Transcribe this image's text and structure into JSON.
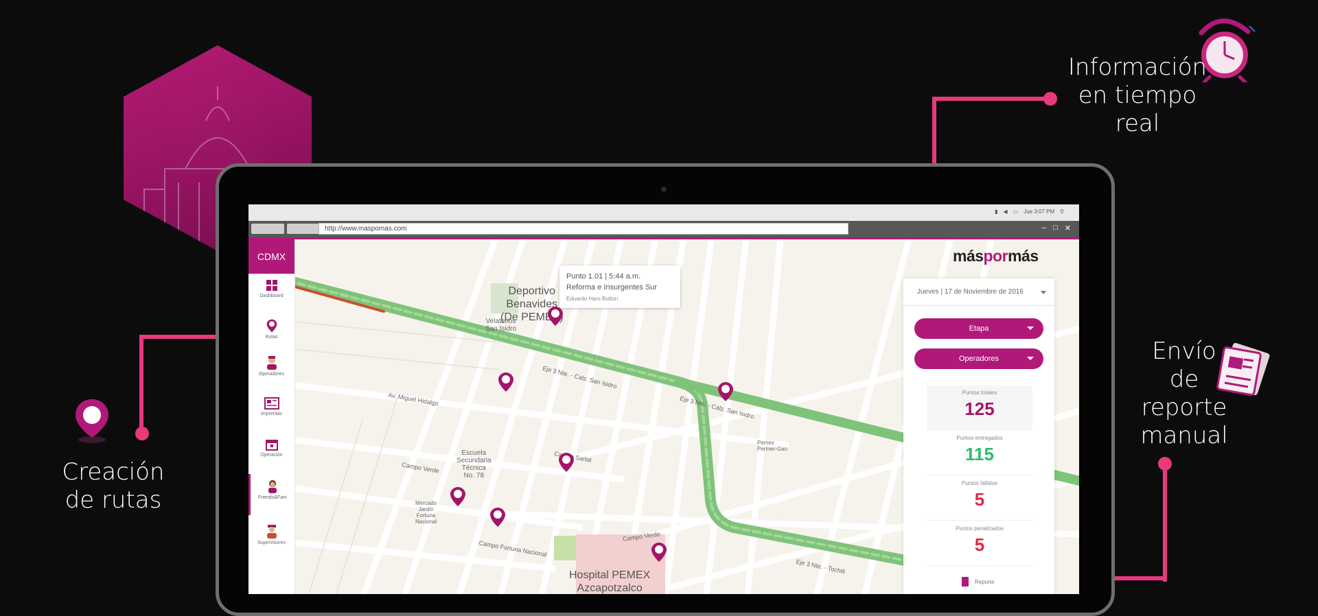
{
  "callouts": {
    "realtime": [
      "Información",
      "en tiempo",
      "real"
    ],
    "routes": [
      "Creación",
      "de rutas"
    ],
    "report": [
      "Envío",
      "de",
      "reporte",
      "manual"
    ]
  },
  "browser": {
    "url": "http://www.maspomas.com",
    "tray_time": "Jue 3:07 PM"
  },
  "app": {
    "city": "CDMX",
    "logo_prefix": "más",
    "logo_mid": "por",
    "logo_suffix": "más",
    "accent": "#b0197a",
    "nav": [
      {
        "label": "Dashboard",
        "icon": "dashboard-icon"
      },
      {
        "label": "Rutas",
        "icon": "map-pin-icon"
      },
      {
        "label": "Operadores",
        "icon": "operator-icon"
      },
      {
        "label": "Imprentas",
        "icon": "newspaper-icon"
      },
      {
        "label": "Operación",
        "icon": "calendar-icon"
      },
      {
        "label": "Friends&Fam",
        "icon": "person-icon"
      },
      {
        "label": "Supervisores",
        "icon": "supervisor-icon"
      }
    ]
  },
  "popup": {
    "line1": "Punto 1.01 | 5:44 a.m.",
    "line2": "Reforma e Insurgentes Sur",
    "line3": "Eduardo Haro Button"
  },
  "map_labels": {
    "deportivo": [
      "Deportivo",
      "Benavides",
      "(De PEMEX)"
    ],
    "hospital": [
      "Hospital PEMEX",
      "Azcapotzalco"
    ],
    "velatorios": [
      "Velatorios",
      "San Isidro"
    ],
    "escuela": [
      "Escuela",
      "Secundaria",
      "Técnica",
      "No. 78"
    ],
    "mercado": [
      "Mercado",
      "Jardín",
      "Fortuna",
      "Nacional"
    ],
    "pemex": [
      "Pemex",
      "Permer-Gan"
    ],
    "eje3": "Eje 3 Nte. - Calz. San Isidro",
    "eje3b": "Eje 3 Nte. - Calz. San Isidro",
    "miguel": "Av. Miguel Hidalgo",
    "campo_verde": "Campo Verde",
    "campo_sarlat": "Campo Sarlat",
    "campo_fortuna": "Campo Fortuna Nacional",
    "campo_verde2": "Campo Verde",
    "eje3tochtli": "Eje 3 Nte. - Tochtli"
  },
  "panel": {
    "date": "Jueves | 17 de Noviembre de 2016",
    "etapa": "Etapa",
    "operadores": "Operadores",
    "stats": [
      {
        "label": "Puntos totales",
        "value": "125",
        "color": "#a3156a"
      },
      {
        "label": "Puntos entregados",
        "value": "115",
        "color": "#2bbf6a"
      },
      {
        "label": "Puntos fallidos",
        "value": "5",
        "color": "#e0294a"
      },
      {
        "label": "Puntos penalizados",
        "value": "5",
        "color": "#e0294a"
      }
    ],
    "report": "Reporte"
  }
}
